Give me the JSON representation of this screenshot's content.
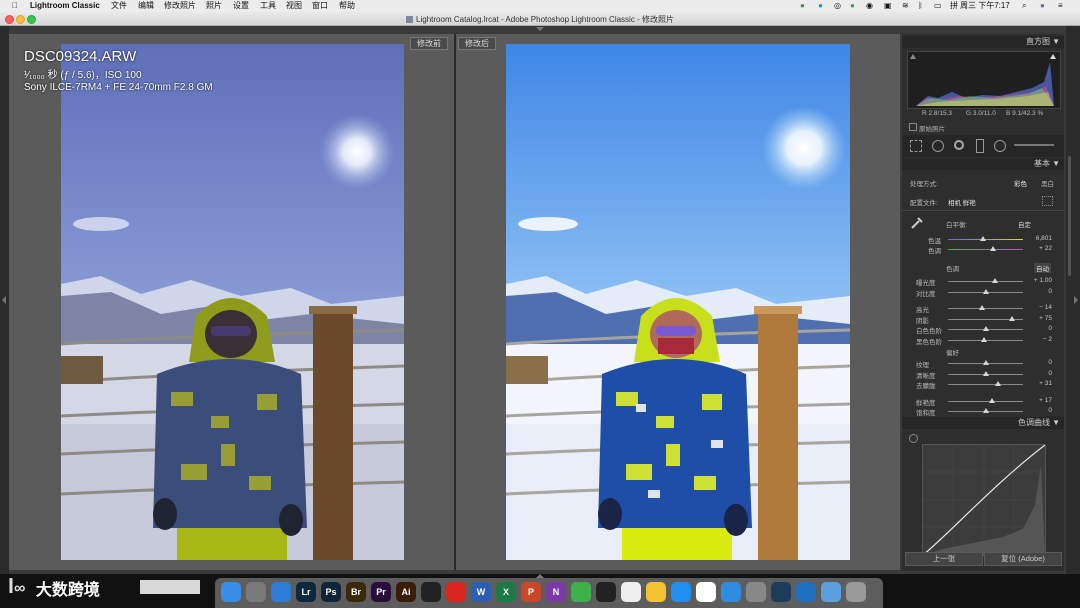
{
  "menubar": {
    "app": "Lightroom Classic",
    "items": [
      "文件",
      "编辑",
      "修改照片",
      "照片",
      "设置",
      "工具",
      "视图",
      "窗口",
      "帮助"
    ],
    "clock": "周三 下午7:17"
  },
  "window": {
    "title": "Lightroom Catalog.lrcat - Adobe Photoshop Lightroom Classic - 修改照片"
  },
  "compare": {
    "before_label": "修改前",
    "after_label": "修改后",
    "filename": "DSC09324.ARW",
    "exposure": "¹⁄₁₀₀₀ 秒 (ƒ / 5.6)，ISO 100",
    "camera": "Sony ILCE-7RM4 + FE 24-70mm F2.8 GM"
  },
  "panel": {
    "histogram": {
      "title": "直方图",
      "readout_r": "R 2.8/15.3",
      "readout_g": "G 3.0/11.0",
      "readout_b": "B 9.1/42.3 %",
      "original_photo": "原始照片"
    },
    "basic": {
      "title": "基本",
      "treatment_label": "处理方式:",
      "treatment_color": "彩色",
      "treatment_bw": "黑白",
      "profile_label": "配置文件:",
      "profile_value": "相机 鲜艳",
      "wb_label": "白平衡:",
      "wb_value": "自定",
      "temp_label": "色温",
      "temp_value": "6,801",
      "tint_label": "色调",
      "tint_value": "+ 22",
      "tone_label": "色调",
      "tone_auto": "自动",
      "sliders_tone": [
        {
          "label": "曝光度",
          "value": "+ 1.00"
        },
        {
          "label": "对比度",
          "value": "0"
        },
        {
          "label": "高光",
          "value": "− 14"
        },
        {
          "label": "阴影",
          "value": "+ 75"
        },
        {
          "label": "白色色阶",
          "value": "0"
        },
        {
          "label": "黑色色阶",
          "value": "− 2"
        }
      ],
      "presence_label": "偏好",
      "sliders_presence": [
        {
          "label": "纹理",
          "value": "0"
        },
        {
          "label": "清晰度",
          "value": "0"
        },
        {
          "label": "去朦胧",
          "value": "+ 31"
        },
        {
          "label": "鲜艳度",
          "value": "+ 17"
        },
        {
          "label": "饱和度",
          "value": "0"
        }
      ]
    },
    "tone_curve": {
      "title": "色调曲线"
    },
    "buttons": {
      "previous": "上一张",
      "reset": "复位 (Adobe)"
    }
  },
  "watermark": {
    "brand": "大数跨境"
  },
  "dock": {
    "apps": [
      {
        "name": "finder-icon",
        "label": "",
        "color": "#3b8ee8"
      },
      {
        "name": "launchpad-icon",
        "label": "",
        "color": "#7a7a7a"
      },
      {
        "name": "safari-icon",
        "label": "",
        "color": "#2d7cd6"
      },
      {
        "name": "lightroom-icon",
        "label": "Lr",
        "color": "#0b2a3d"
      },
      {
        "name": "photoshop-icon",
        "label": "Ps",
        "color": "#0f2438"
      },
      {
        "name": "bridge-icon",
        "label": "Br",
        "color": "#3a2a08"
      },
      {
        "name": "premiere-icon",
        "label": "Pr",
        "color": "#2a0b3a"
      },
      {
        "name": "illustrator-icon",
        "label": "Ai",
        "color": "#3a1d06"
      },
      {
        "name": "media-encoder-icon",
        "label": "",
        "color": "#222"
      },
      {
        "name": "creative-cloud-icon",
        "label": "",
        "color": "#d9271e"
      },
      {
        "name": "word-icon",
        "label": "W",
        "color": "#2b5fb4"
      },
      {
        "name": "excel-icon",
        "label": "X",
        "color": "#1e7a45"
      },
      {
        "name": "powerpoint-icon",
        "label": "P",
        "color": "#c8492a"
      },
      {
        "name": "onenote-icon",
        "label": "N",
        "color": "#7a3aa6"
      },
      {
        "name": "wechat-icon",
        "label": "",
        "color": "#3cb34a"
      },
      {
        "name": "qq-icon",
        "label": "",
        "color": "#222"
      },
      {
        "name": "photos-icon",
        "label": "",
        "color": "#eee"
      },
      {
        "name": "notes-icon",
        "label": "",
        "color": "#f2c230"
      },
      {
        "name": "app-store-icon",
        "label": "",
        "color": "#1f8ff0"
      },
      {
        "name": "baidu-netdisk-icon",
        "label": "",
        "color": "#fff"
      },
      {
        "name": "cloud-icon",
        "label": "",
        "color": "#2d8ce0"
      },
      {
        "name": "system-prefs-icon",
        "label": "",
        "color": "#888"
      },
      {
        "name": "quicktime-icon",
        "label": "",
        "color": "#1b3c5a"
      },
      {
        "name": "edge-icon",
        "label": "",
        "color": "#1f6fbf"
      },
      {
        "name": "folder-icon",
        "label": "",
        "color": "#5aa0e0"
      },
      {
        "name": "trash-icon",
        "label": "",
        "color": "#999"
      }
    ]
  }
}
